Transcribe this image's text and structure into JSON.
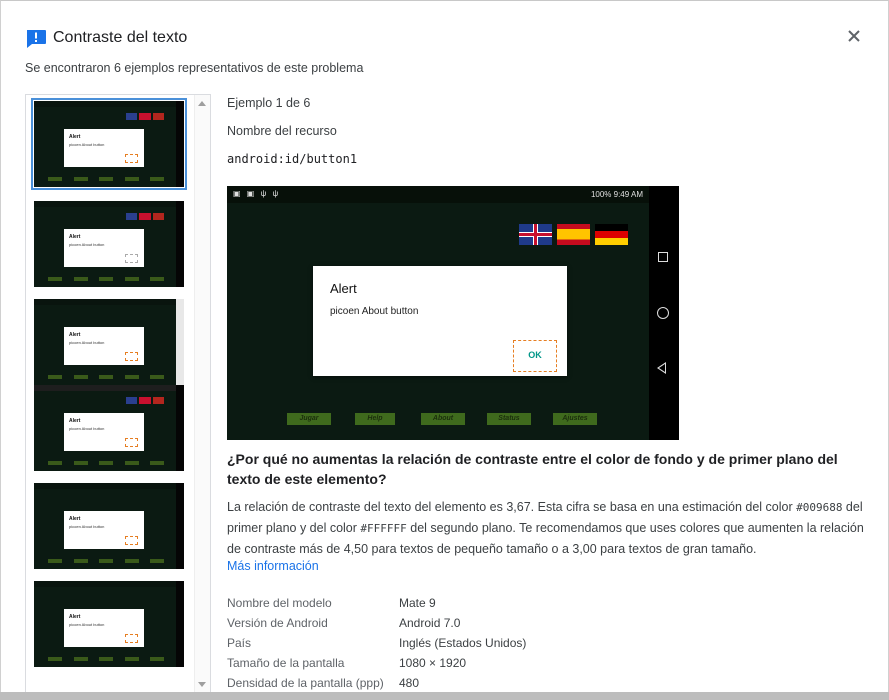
{
  "dialog": {
    "title": "Contraste del texto",
    "subtitle": "Se encontraron 6 ejemplos representativos de este problema",
    "close_icon": "close-icon",
    "title_icon": "feedback-icon",
    "accent": "#1a73e8"
  },
  "thumbnails": [
    {
      "selected": true
    },
    {
      "selected": false
    },
    {
      "selected": false
    },
    {
      "selected": false
    },
    {
      "selected": false
    },
    {
      "selected": false
    }
  ],
  "detail": {
    "example_label": "Ejemplo 1 de 6",
    "resource_label": "Nombre del recurso",
    "resource_id": "android:id/button1",
    "screenshot": {
      "status_right": "100%  9:49 AM",
      "alert_title": "Alert",
      "alert_message": "picoen About button",
      "ok_label": "OK",
      "game_buttons": [
        "Jugar",
        "Help",
        "About",
        "Status",
        "Ajustes"
      ]
    },
    "question": "¿Por qué no aumentas la relación de contraste entre el color de fondo y de primer plano del texto de este elemento?",
    "desc_part1": "La relación de contraste del texto del elemento es 3,67. Esta cifra se basa en una estimación del color ",
    "fg_color": "#009688",
    "desc_part2": " del primer plano y del color ",
    "bg_color": "#FFFFFF",
    "desc_part3": " del segundo plano. Te recomendamos que uses colores que aumenten la relación de contraste más de 4,50 para textos de pequeño tamaño o a 3,00 para textos de gran tamaño.",
    "more_info": "Más información"
  },
  "properties": [
    {
      "key": "Nombre del modelo",
      "value": "Mate 9"
    },
    {
      "key": "Versión de Android",
      "value": "Android 7.0"
    },
    {
      "key": "País",
      "value": "Inglés (Estados Unidos)"
    },
    {
      "key": "Tamaño de la pantalla",
      "value": "1080 × 1920"
    },
    {
      "key": "Densidad de la pantalla (ppp)",
      "value": "480"
    }
  ]
}
